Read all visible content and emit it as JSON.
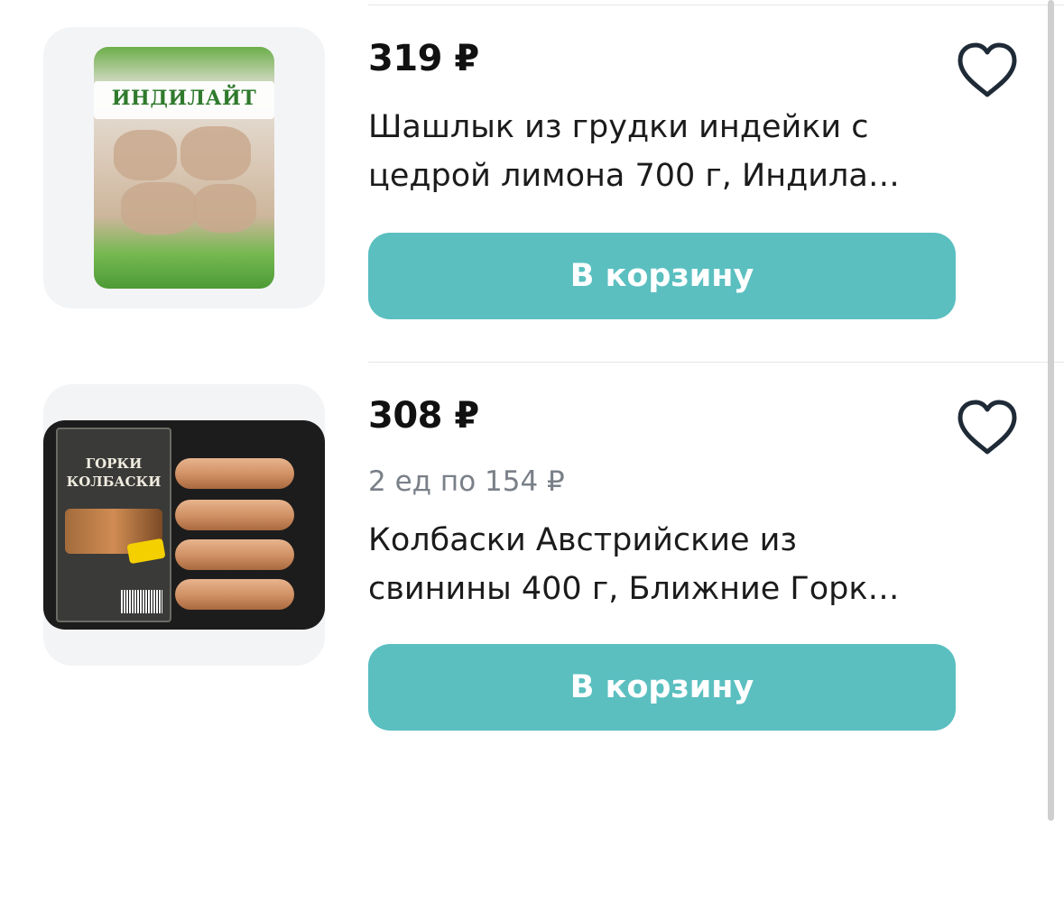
{
  "products": [
    {
      "price": "319 ₽",
      "title": "Шашлык из грудки индейки с цедрой лимона 700 г, Индила…",
      "image_brand": "ИНДИЛАЙТ",
      "button_label": "В корзину",
      "favorite_icon": "heart-outline-icon"
    },
    {
      "price": "308 ₽",
      "unit_price": "2 ед по 154 ₽",
      "title": "Колбаски Австрийские из свинины 400 г, Ближние Горк…",
      "image_brand": "ГОРКИ КОЛБАСКИ",
      "button_label": "В корзину",
      "favorite_icon": "heart-outline-icon"
    }
  ],
  "colors": {
    "accent": "#5bbfc0",
    "text": "#1b1b1b",
    "muted": "#7a8088",
    "thumb_bg": "#f3f4f6"
  }
}
